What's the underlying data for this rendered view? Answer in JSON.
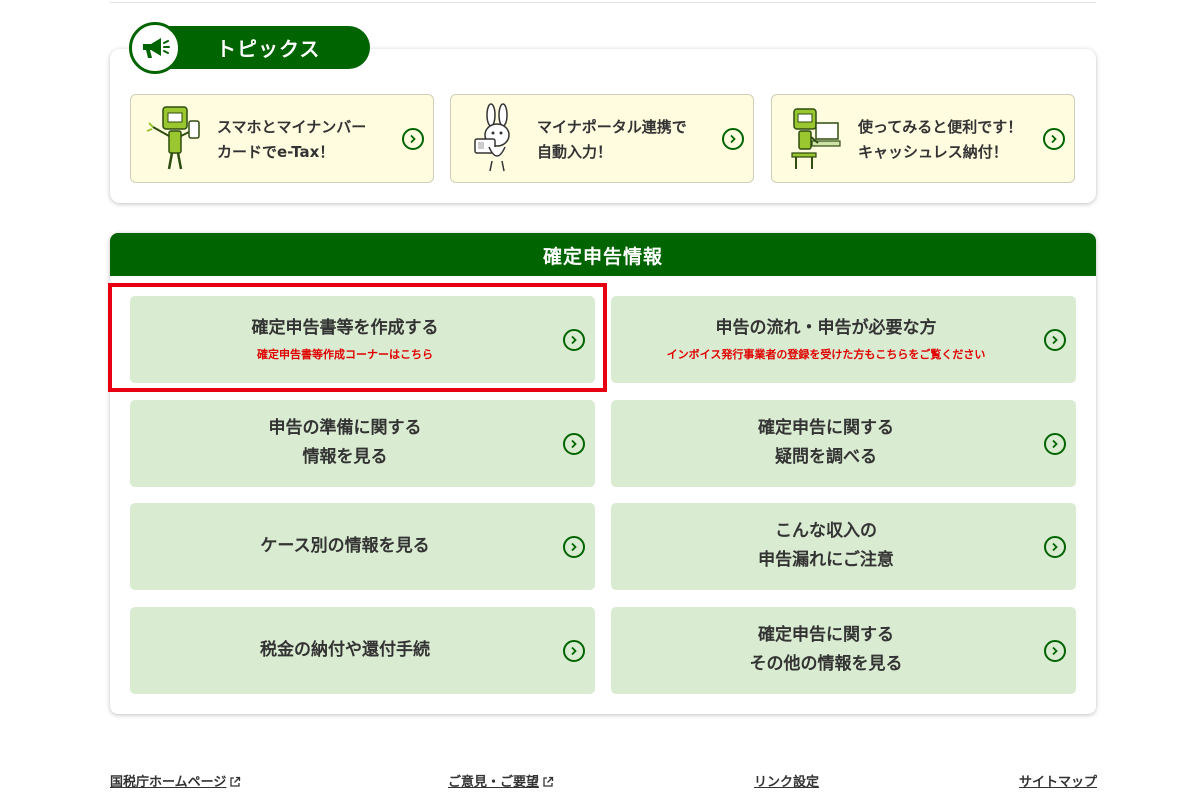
{
  "topics": {
    "title": "トピックス",
    "cards": [
      {
        "line1": "スマホとマイナンバー",
        "line2": "カードでe-Tax！"
      },
      {
        "line1": "マイナポータル連携で",
        "line2": "自動入力！"
      },
      {
        "line1": "使ってみると便利です！",
        "line2": "キャッシュレス納付！"
      }
    ]
  },
  "kakutei": {
    "title": "確定申告情報",
    "items": [
      {
        "line1": "確定申告書等を作成する",
        "sub": "確定申告書等作成コーナーはこちら"
      },
      {
        "line1": "申告の流れ・申告が必要な方",
        "sub": "インボイス発行事業者の登録を受けた方もこちらをご覧ください"
      },
      {
        "line1": "申告の準備に関する",
        "line2": "情報を見る"
      },
      {
        "line1": "確定申告に関する",
        "line2": "疑問を調べる"
      },
      {
        "line1": "ケース別の情報を見る"
      },
      {
        "line1": "こんな収入の",
        "line2": "申告漏れにご注意"
      },
      {
        "line1": "税金の納付や還付手続"
      },
      {
        "line1": "確定申告に関する",
        "line2": "その他の情報を見る"
      }
    ]
  },
  "footer": {
    "links": [
      "国税庁ホームページ",
      "ご意見・ご要望",
      "リンク設定",
      "サイトマップ"
    ]
  },
  "colors": {
    "primary_green": "#006400",
    "item_bg": "#d9ebd1",
    "topic_card_bg": "#fffce0",
    "highlight_red": "#e60012",
    "sub_text_red": "#e00000"
  }
}
